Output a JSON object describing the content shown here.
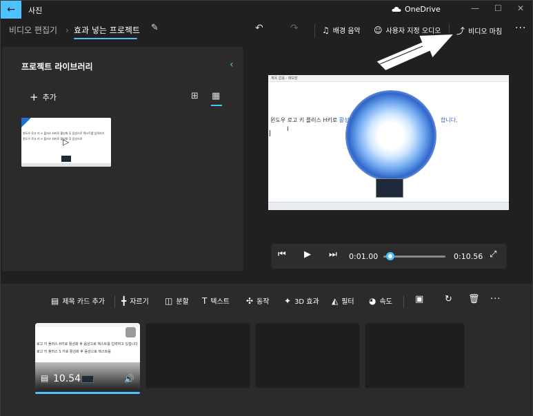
{
  "titlebar": {
    "app_name": "사진",
    "onedrive": "OneDrive",
    "minimize": "—",
    "maximize": "☐",
    "close": "✕"
  },
  "tabs": {
    "video_editor": "비디오 편집기",
    "project": "효과 넣는 프로젝트"
  },
  "toolbar": {
    "background_music": "배경 음악",
    "custom_audio": "사용자 지정 오디오",
    "finish_video": "비디오 마침",
    "more": "···"
  },
  "library": {
    "title": "프로젝트 라이브러리",
    "add_label": "추가",
    "thumb_line1": "윈도우 로고 키 + 플러스 H키로 활성화 후 음성으로 텍스트를 입력하기",
    "thumb_line2": "윈도우 로고 키 + 플러스 H키로 활성화 후 음성으로"
  },
  "preview": {
    "text_left": "윈도우 로고 키 플러스 H키로",
    "text_left_hl": "활성화",
    "text_right": "합니다.",
    "cursor": "I",
    "title_small": "제목 없음 - 메모장"
  },
  "player": {
    "current_time": "0:01.00",
    "total_time": "0:10.56",
    "progress": 0.095
  },
  "storyboard": {
    "add_title_card": "제목 카드 추가",
    "trim": "자르기",
    "split": "분할",
    "text": "텍스트",
    "motion": "동작",
    "effects_3d": "3D 효과",
    "filters": "필터",
    "speed": "속도",
    "clip_duration": "10.54",
    "clip_line1": "로고 키 플러스 H키로 활성화 후 음성으로 텍스트를 입력하고 있습니다",
    "clip_line2": "로고 키 플러스 S 키로 활성화 후 음성으로 텍스트를"
  },
  "colors": {
    "accent": "#4cc2ff",
    "background": "#202020",
    "panel": "#2b2b2b"
  },
  "icons": [
    "back-arrow-icon",
    "cloud-icon",
    "pencil-icon",
    "undo-icon",
    "redo-icon",
    "music-note-icon",
    "person-audio-icon",
    "share-icon",
    "chevron-left-icon",
    "plus-icon",
    "grid-large-icon",
    "grid-small-icon",
    "play-icon",
    "skip-back-icon",
    "skip-forward-icon",
    "fullscreen-icon",
    "title-card-icon",
    "trim-icon",
    "split-icon",
    "text-icon",
    "motion-icon",
    "3d-effects-icon",
    "filter-icon",
    "speed-icon",
    "resize-icon",
    "rotate-icon",
    "trash-icon",
    "film-icon",
    "volume-icon"
  ]
}
